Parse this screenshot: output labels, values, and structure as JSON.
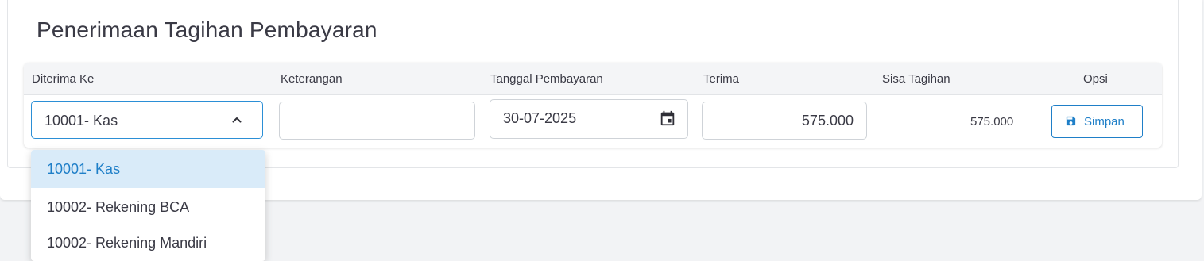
{
  "page": {
    "title": "Penerimaan Tagihan Pembayaran"
  },
  "table": {
    "headers": {
      "diterima_ke": "Diterima Ke",
      "keterangan": "Keterangan",
      "tanggal": "Tanggal Pembayaran",
      "terima": "Terima",
      "sisa": "Sisa Tagihan",
      "opsi": "Opsi"
    },
    "row": {
      "account": "10001- Kas",
      "keterangan": "",
      "tanggal": "30-07-2025",
      "terima": "575.000",
      "sisa": "575.000",
      "save_label": "Simpan"
    }
  },
  "dropdown": {
    "options": [
      {
        "label": "10001- Kas",
        "selected": true
      },
      {
        "label": "10002- Rekening BCA",
        "selected": false
      },
      {
        "label": "10002- Rekening Mandiri",
        "selected": false
      }
    ]
  },
  "colors": {
    "accent": "#1f7fc8",
    "selected_bg": "#d9ebf9"
  },
  "icons": {
    "select": "chevron-up-icon",
    "date": "calendar-icon",
    "save": "save-icon"
  }
}
